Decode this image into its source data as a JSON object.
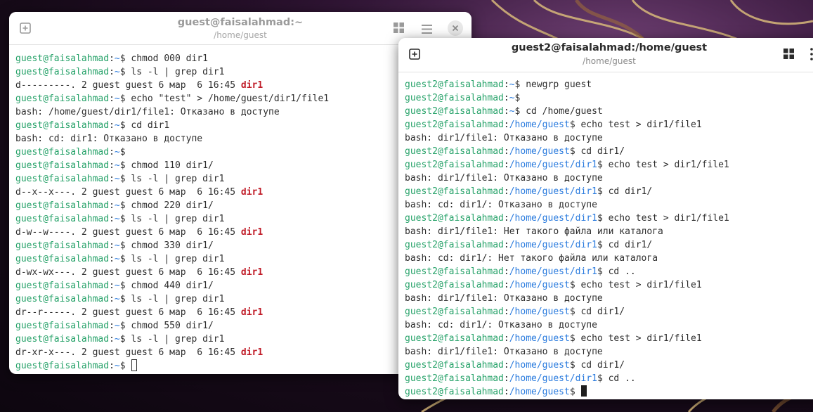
{
  "term1": {
    "title": "guest@faisalahmad:~",
    "subtitle": "/home/guest",
    "new_tab_icon": "plus-square-icon",
    "grid_icon": "grid-icon",
    "menu_icon": "hamburger-menu-icon",
    "close_icon": "close-icon",
    "prompt": "guest@faisalahmad",
    "lines": [
      {
        "kind": "cmd",
        "path": "~",
        "cmd": "$ chmod 000 dir1"
      },
      {
        "kind": "cmd",
        "path": "~",
        "cmd": "$ ls -l | grep dir1"
      },
      {
        "kind": "ls",
        "perm": "d---------. 2 guest guest 6 мар  6 16:45 ",
        "name": "dir1"
      },
      {
        "kind": "cmd",
        "path": "~",
        "cmd": "$ echo \"test\" > /home/guest/dir1/file1"
      },
      {
        "kind": "out",
        "text": "bash: /home/guest/dir1/file1: Отказано в доступе"
      },
      {
        "kind": "cmd",
        "path": "~",
        "cmd": "$ cd dir1"
      },
      {
        "kind": "out",
        "text": "bash: cd: dir1: Отказано в доступе"
      },
      {
        "kind": "cmd",
        "path": "~",
        "cmd": "$"
      },
      {
        "kind": "cmd",
        "path": "~",
        "cmd": "$ chmod 110 dir1/"
      },
      {
        "kind": "cmd",
        "path": "~",
        "cmd": "$ ls -l | grep dir1"
      },
      {
        "kind": "ls",
        "perm": "d--x--x---. 2 guest guest 6 мар  6 16:45 ",
        "name": "dir1"
      },
      {
        "kind": "cmd",
        "path": "~",
        "cmd": "$ chmod 220 dir1/"
      },
      {
        "kind": "cmd",
        "path": "~",
        "cmd": "$ ls -l | grep dir1"
      },
      {
        "kind": "ls",
        "perm": "d-w--w----. 2 guest guest 6 мар  6 16:45 ",
        "name": "dir1"
      },
      {
        "kind": "cmd",
        "path": "~",
        "cmd": "$ chmod 330 dir1/"
      },
      {
        "kind": "cmd",
        "path": "~",
        "cmd": "$ ls -l | grep dir1"
      },
      {
        "kind": "ls",
        "perm": "d-wx-wx---. 2 guest guest 6 мар  6 16:45 ",
        "name": "dir1"
      },
      {
        "kind": "cmd",
        "path": "~",
        "cmd": "$ chmod 440 dir1/"
      },
      {
        "kind": "cmd",
        "path": "~",
        "cmd": "$ ls -l | grep dir1"
      },
      {
        "kind": "ls",
        "perm": "dr--r-----. 2 guest guest 6 мар  6 16:45 ",
        "name": "dir1"
      },
      {
        "kind": "cmd",
        "path": "~",
        "cmd": "$ chmod 550 dir1/"
      },
      {
        "kind": "cmd",
        "path": "~",
        "cmd": "$ ls -l | grep dir1"
      },
      {
        "kind": "ls",
        "perm": "dr-xr-x---. 2 guest guest 6 мар  6 16:45 ",
        "name": "dir1"
      },
      {
        "kind": "cursor",
        "path": "~",
        "cmd": "$ "
      }
    ]
  },
  "term2": {
    "title": "guest2@faisalahmad:/home/guest",
    "subtitle": "/home/guest",
    "new_tab_icon": "plus-square-icon",
    "grid_icon": "grid-icon",
    "menu_icon": "kebab-menu-icon",
    "prompt": "guest2@faisalahmad",
    "lines": [
      {
        "kind": "cmd",
        "path": "~",
        "cmd": "$ newgrp guest"
      },
      {
        "kind": "cmd",
        "path": "~",
        "cmd": "$"
      },
      {
        "kind": "cmd",
        "path": "~",
        "cmd": "$ cd /home/guest"
      },
      {
        "kind": "cmd",
        "path": "/home/guest",
        "cmd": "$ echo test > dir1/file1"
      },
      {
        "kind": "out",
        "text": "bash: dir1/file1: Отказано в доступе"
      },
      {
        "kind": "cmd",
        "path": "/home/guest",
        "cmd": "$ cd dir1/"
      },
      {
        "kind": "cmd",
        "path": "/home/guest/dir1",
        "cmd": "$ echo test > dir1/file1"
      },
      {
        "kind": "out",
        "text": "bash: dir1/file1: Отказано в доступе"
      },
      {
        "kind": "cmd",
        "path": "/home/guest/dir1",
        "cmd": "$ cd dir1/"
      },
      {
        "kind": "out",
        "text": "bash: cd: dir1/: Отказано в доступе"
      },
      {
        "kind": "cmd",
        "path": "/home/guest/dir1",
        "cmd": "$ echo test > dir1/file1"
      },
      {
        "kind": "out",
        "text": "bash: dir1/file1: Нет такого файла или каталога"
      },
      {
        "kind": "cmd",
        "path": "/home/guest/dir1",
        "cmd": "$ cd dir1/"
      },
      {
        "kind": "out",
        "text": "bash: cd: dir1/: Нет такого файла или каталога"
      },
      {
        "kind": "cmd",
        "path": "/home/guest/dir1",
        "cmd": "$ cd .."
      },
      {
        "kind": "cmd",
        "path": "/home/guest",
        "cmd": "$ echo test > dir1/file1"
      },
      {
        "kind": "out",
        "text": "bash: dir1/file1: Отказано в доступе"
      },
      {
        "kind": "cmd",
        "path": "/home/guest",
        "cmd": "$ cd dir1/"
      },
      {
        "kind": "out",
        "text": "bash: cd: dir1/: Отказано в доступе"
      },
      {
        "kind": "cmd",
        "path": "/home/guest",
        "cmd": "$ echo test > dir1/file1"
      },
      {
        "kind": "out",
        "text": "bash: dir1/file1: Отказано в доступе"
      },
      {
        "kind": "cmd",
        "path": "/home/guest",
        "cmd": "$ cd dir1/"
      },
      {
        "kind": "cmd",
        "path": "/home/guest/dir1",
        "cmd": "$ cd .."
      },
      {
        "kind": "cursor",
        "path": "/home/guest",
        "cmd": "$ "
      }
    ]
  },
  "colors": {
    "prompt_user": "#26a269",
    "prompt_path": "#2a7bde",
    "dir_name": "#c01c28"
  }
}
